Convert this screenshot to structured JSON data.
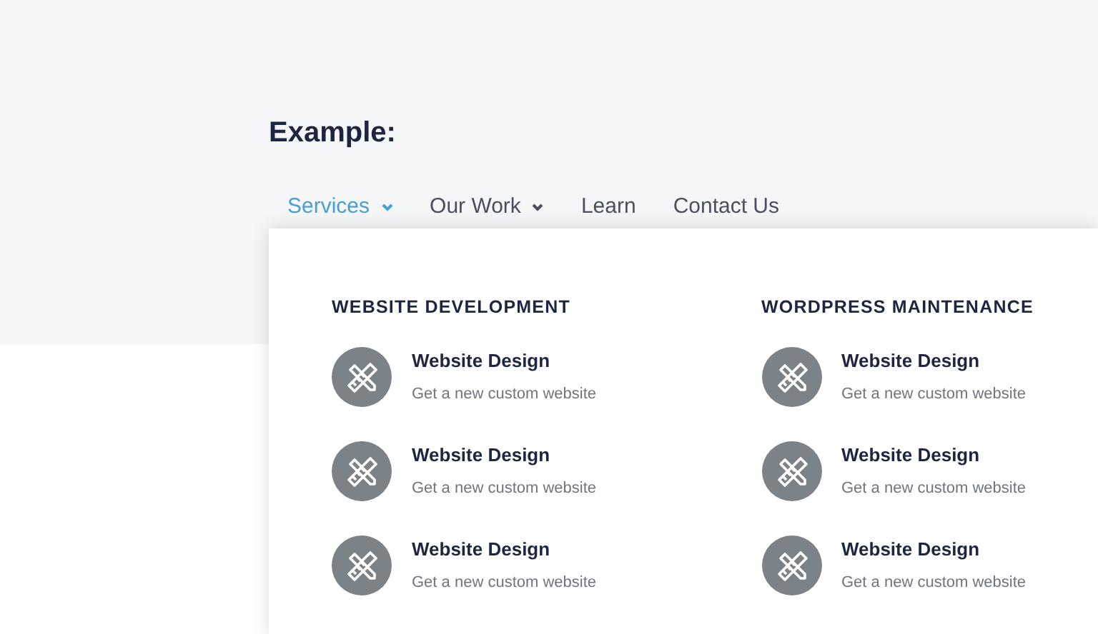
{
  "heading": "Example:",
  "nav": [
    {
      "label": "Services",
      "selected": true,
      "has_dropdown": true
    },
    {
      "label": "Our Work",
      "selected": false,
      "has_dropdown": true
    },
    {
      "label": "Learn",
      "selected": false,
      "has_dropdown": false
    },
    {
      "label": "Contact Us",
      "selected": false,
      "has_dropdown": false
    }
  ],
  "dropdown": {
    "columns": [
      {
        "title": "WEBSITE DEVELOPMENT",
        "items": [
          {
            "title": "Website Design",
            "description": "Get a new custom website"
          },
          {
            "title": "Website Design",
            "description": "Get a new custom website"
          },
          {
            "title": "Website Design",
            "description": "Get a new custom website"
          }
        ]
      },
      {
        "title": "WORDPRESS MAINTENANCE",
        "items": [
          {
            "title": "Website Design",
            "description": "Get a new custom website"
          },
          {
            "title": "Website Design",
            "description": "Get a new custom website"
          },
          {
            "title": "Website Design",
            "description": "Get a new custom website"
          }
        ]
      }
    ]
  }
}
